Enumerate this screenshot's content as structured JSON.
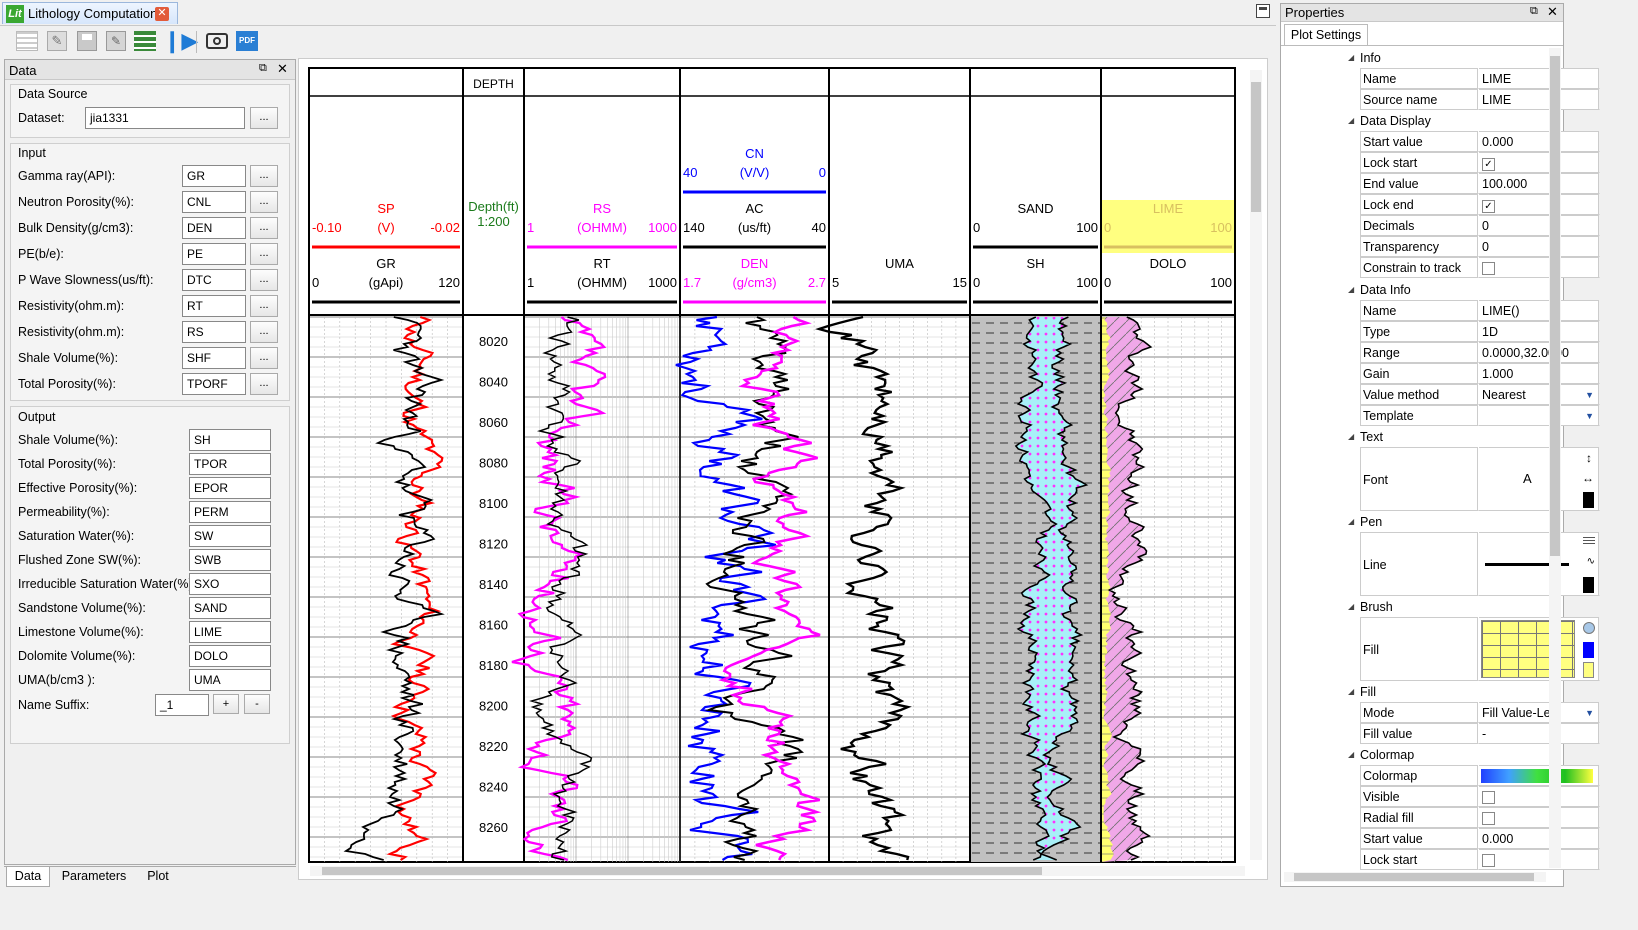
{
  "window": {
    "tab_title": "Lithology Computation",
    "app_icon": "Lit"
  },
  "toolbar": {
    "icons": [
      "list-icon",
      "edit-icon",
      "save-icon",
      "save-as-icon",
      "layers-icon",
      "run-icon",
      "camera-icon",
      "pdf-icon"
    ]
  },
  "data_panel": {
    "title": "Data",
    "data_source": {
      "group_label": "Data Source",
      "dataset_label": "Dataset:",
      "dataset_value": "jia1331",
      "browse_label": "..."
    },
    "input": {
      "group_label": "Input",
      "items": [
        {
          "label": "Gamma ray(API):",
          "value": "GR"
        },
        {
          "label": "Neutron Porosity(%):",
          "value": "CNL"
        },
        {
          "label": "Bulk Density(g/cm3):",
          "value": "DEN"
        },
        {
          "label": "PE(b/e):",
          "value": "PE"
        },
        {
          "label": "P Wave Slowness(us/ft):",
          "value": "DTC"
        },
        {
          "label": "Resistivity(ohm.m):",
          "value": "RT"
        },
        {
          "label": "Resistivity(ohm.m):",
          "value": "RS"
        },
        {
          "label": "Shale Volume(%):",
          "value": "SHF"
        },
        {
          "label": "Total Porosity(%):",
          "value": "TPORF"
        }
      ]
    },
    "output": {
      "group_label": "Output",
      "items": [
        {
          "label": "Shale Volume(%):",
          "value": "SH"
        },
        {
          "label": "Total Porosity(%):",
          "value": "TPOR"
        },
        {
          "label": "Effective Porosity(%):",
          "value": "EPOR"
        },
        {
          "label": "Permeability(%):",
          "value": "PERM"
        },
        {
          "label": "Saturation Water(%):",
          "value": "SW"
        },
        {
          "label": "Flushed Zone SW(%):",
          "value": "SWB"
        },
        {
          "label": "Irreducible Saturation Water(%):",
          "value": "SXO"
        },
        {
          "label": "Sandstone Volume(%):",
          "value": "SAND"
        },
        {
          "label": "Limestone Volume(%):",
          "value": "LIME"
        },
        {
          "label": "Dolomite Volume(%):",
          "value": "DOLO"
        },
        {
          "label": "UMA(b/cm3 ):",
          "value": "UMA"
        }
      ],
      "suffix_label": "Name Suffix:",
      "suffix_value": "_1",
      "plus_label": "+",
      "minus_label": "-"
    },
    "bottom_tabs": [
      "Data",
      "Parameters",
      "Plot"
    ]
  },
  "plot": {
    "depth_header": "DEPTH",
    "depth_unit": "Depth(ft)",
    "depth_scale": "1:200",
    "depth_ticks": [
      "8020",
      "8040",
      "8060",
      "8080",
      "8100",
      "8120",
      "8140",
      "8160",
      "8180",
      "8200",
      "8220",
      "8240",
      "8260"
    ],
    "tracks": [
      {
        "curves": [
          {
            "name": "SP",
            "unit": "(V)",
            "min": "-0.10",
            "max": "-0.02",
            "color": "#ff0000"
          },
          {
            "name": "GR",
            "unit": "(gApi)",
            "min": "0",
            "max": "120",
            "color": "#000000"
          }
        ]
      },
      {
        "curves": [
          {
            "name": "RS",
            "unit": "(OHMM)",
            "min": "1",
            "max": "1000",
            "color": "#ff00ff"
          },
          {
            "name": "RT",
            "unit": "(OHMM)",
            "min": "1",
            "max": "1000",
            "color": "#000000"
          }
        ]
      },
      {
        "curves": [
          {
            "name": "CN",
            "unit": "(V/V)",
            "min": "40",
            "max": "0",
            "color": "#0000ff"
          },
          {
            "name": "AC",
            "unit": "(us/ft)",
            "min": "140",
            "max": "40",
            "color": "#000000"
          },
          {
            "name": "DEN",
            "unit": "(g/cm3)",
            "min": "1.7",
            "max": "2.7",
            "color": "#ff00ff"
          }
        ]
      },
      {
        "curves": [
          {
            "name": "UMA",
            "unit": "",
            "min": "5",
            "max": "15",
            "color": "#000000"
          }
        ]
      },
      {
        "curves": [
          {
            "name": "SAND",
            "unit": "",
            "min": "0",
            "max": "100",
            "color": "#000000"
          },
          {
            "name": "SH",
            "unit": "",
            "min": "0",
            "max": "100",
            "color": "#000000"
          }
        ]
      },
      {
        "curves": [
          {
            "name": "LIME",
            "unit": "",
            "min": "0",
            "max": "100",
            "color": "#d8c060",
            "highlight": "#ffff80"
          },
          {
            "name": "DOLO",
            "unit": "",
            "min": "0",
            "max": "100",
            "color": "#000000"
          }
        ]
      }
    ]
  },
  "properties": {
    "title": "Properties",
    "tab": "Plot Settings",
    "sections": {
      "info": "Info",
      "data_display": "Data Display",
      "data_info": "Data Info",
      "text": "Text",
      "pen": "Pen",
      "brush": "Brush",
      "fill": "Fill",
      "colormap": "Colormap"
    },
    "rows": {
      "name": {
        "k": "Name",
        "v": "LIME"
      },
      "source_name": {
        "k": "Source name",
        "v": "LIME"
      },
      "start_value": {
        "k": "Start value",
        "v": "0.000"
      },
      "lock_start": {
        "k": "Lock start",
        "checked": true
      },
      "end_value": {
        "k": "End value",
        "v": "100.000"
      },
      "lock_end": {
        "k": "Lock end",
        "checked": true
      },
      "decimals": {
        "k": "Decimals",
        "v": "0"
      },
      "transparency": {
        "k": "Transparency",
        "v": "0"
      },
      "constrain": {
        "k": "Constrain to track",
        "checked": false
      },
      "di_name": {
        "k": "Name",
        "v": "LIME()"
      },
      "type": {
        "k": "Type",
        "v": "1D"
      },
      "range": {
        "k": "Range",
        "v": "0.0000,32.0000"
      },
      "gain": {
        "k": "Gain",
        "v": "1.000"
      },
      "value_method": {
        "k": "Value method",
        "v": "Nearest"
      },
      "template": {
        "k": "Template",
        "v": ""
      },
      "font": {
        "k": "Font",
        "v": "A"
      },
      "line": {
        "k": "Line"
      },
      "fill_brush": {
        "k": "Fill"
      },
      "mode": {
        "k": "Mode",
        "v": "Fill Value-Left"
      },
      "fill_value": {
        "k": "Fill value",
        "v": "-"
      },
      "colormap": {
        "k": "Colormap"
      },
      "visible": {
        "k": "Visible",
        "checked": false
      },
      "radial": {
        "k": "Radial fill",
        "checked": false
      },
      "cm_start": {
        "k": "Start value",
        "v": "0.000"
      },
      "cm_lock": {
        "k": "Lock start",
        "checked": false
      }
    }
  }
}
